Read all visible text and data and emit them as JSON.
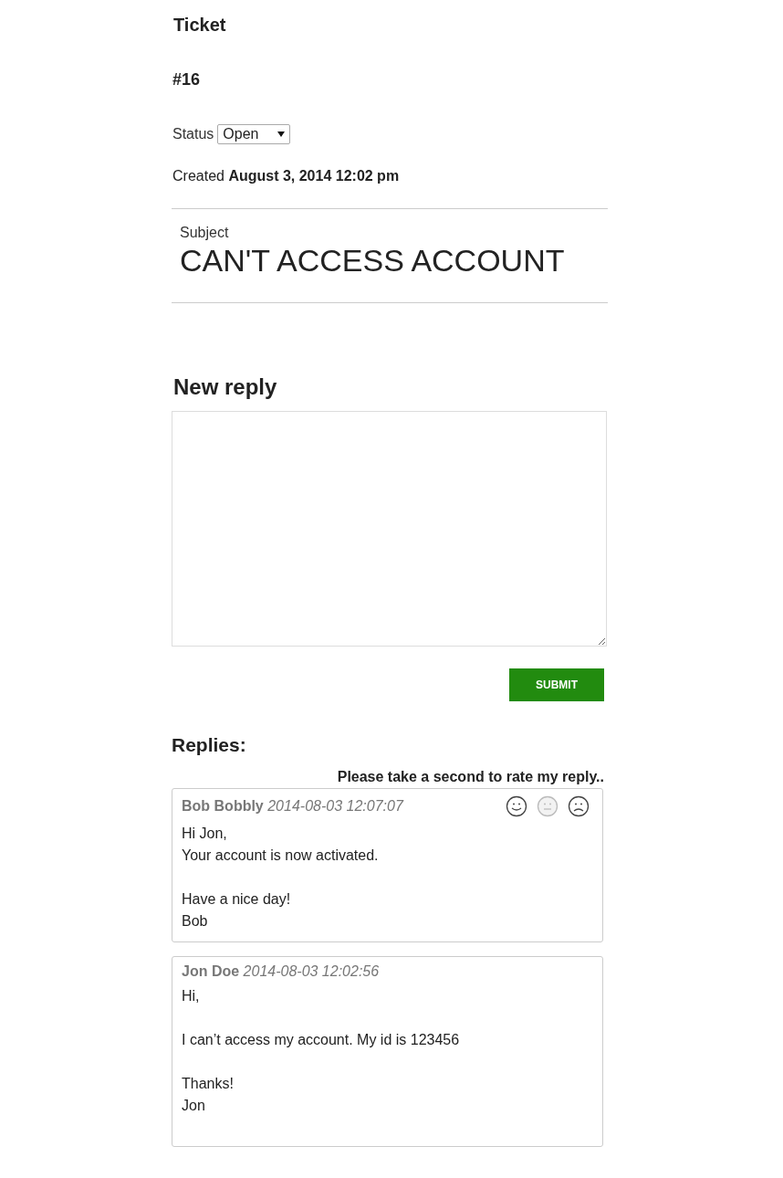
{
  "ticket": {
    "heading": "Ticket",
    "number": "#16",
    "status_label": "Status",
    "status_value": "Open",
    "created_label": "Created",
    "created_value": "August 3, 2014 12:02 pm",
    "subject_label": "Subject",
    "subject": "CAN'T ACCESS ACCOUNT"
  },
  "new_reply": {
    "heading": "New reply",
    "submit": "SUBMIT"
  },
  "replies": {
    "heading": "Replies:",
    "rate_prompt": "Please take a second to rate my reply..",
    "items": [
      {
        "author": "Bob Bobbly",
        "date": "2014-08-03 12:07:07",
        "paragraphs": [
          "Hi Jon,\nYour account is now activated.",
          "Have a nice day!\nBob"
        ],
        "ratings": [
          {
            "kind": "happy",
            "selected": false
          },
          {
            "kind": "neutral",
            "selected": true
          },
          {
            "kind": "sad",
            "selected": false
          }
        ]
      },
      {
        "author": "Jon Doe",
        "date": "2014-08-03 12:02:56",
        "paragraphs": [
          "Hi,",
          "I can’t access my account. My id is 123456",
          "Thanks!\nJon"
        ]
      }
    ]
  }
}
